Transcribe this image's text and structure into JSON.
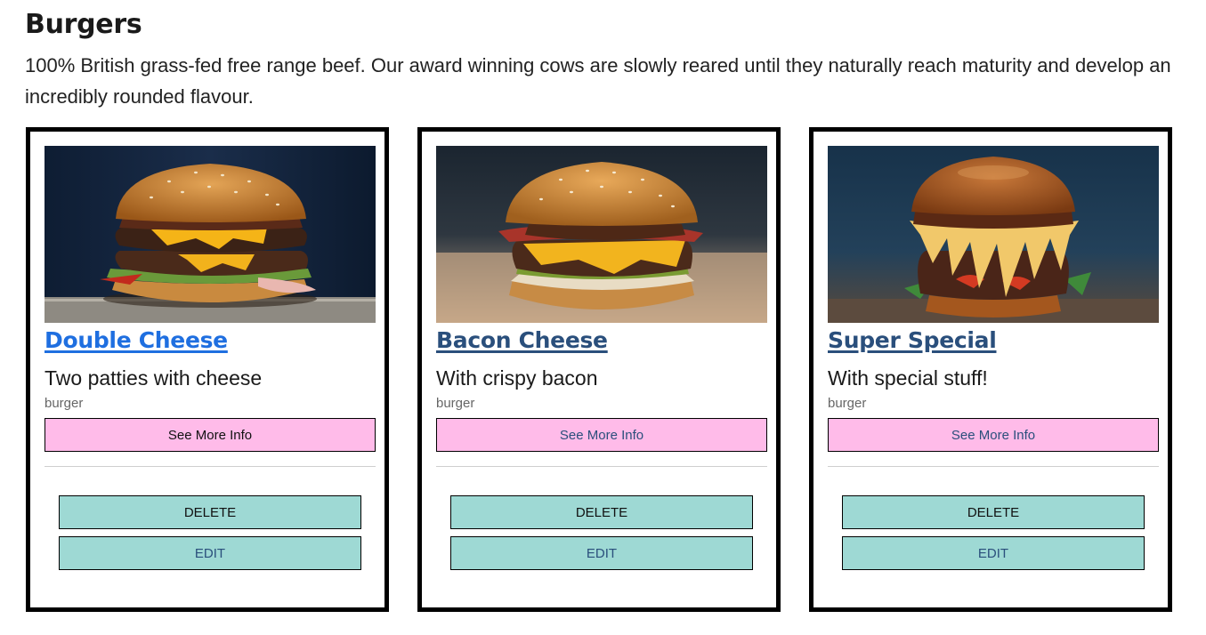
{
  "section": {
    "title": "Burgers",
    "description": "100% British grass-fed free range beef. Our award winning cows are slowly reared until they naturally reach maturity and develop an incredibly rounded flavour."
  },
  "cards": [
    {
      "title": "Double Cheese",
      "description": "Two patties with cheese",
      "category": "burger",
      "more_label": "See More Info",
      "delete_label": "DELETE",
      "edit_label": "EDIT"
    },
    {
      "title": "Bacon Cheese",
      "description": "With crispy bacon",
      "category": "burger",
      "more_label": "See More Info",
      "delete_label": "DELETE",
      "edit_label": "EDIT"
    },
    {
      "title": "Super Special",
      "description": "With special stuff!",
      "category": "burger",
      "more_label": "See More Info",
      "delete_label": "DELETE",
      "edit_label": "EDIT"
    }
  ],
  "colors": {
    "link_active": "#1f6fe0",
    "link_visited": "#2a4f7c",
    "more_button_bg": "#ffbbe9",
    "action_button_bg": "#9ed9d4",
    "card_border": "#000000"
  }
}
